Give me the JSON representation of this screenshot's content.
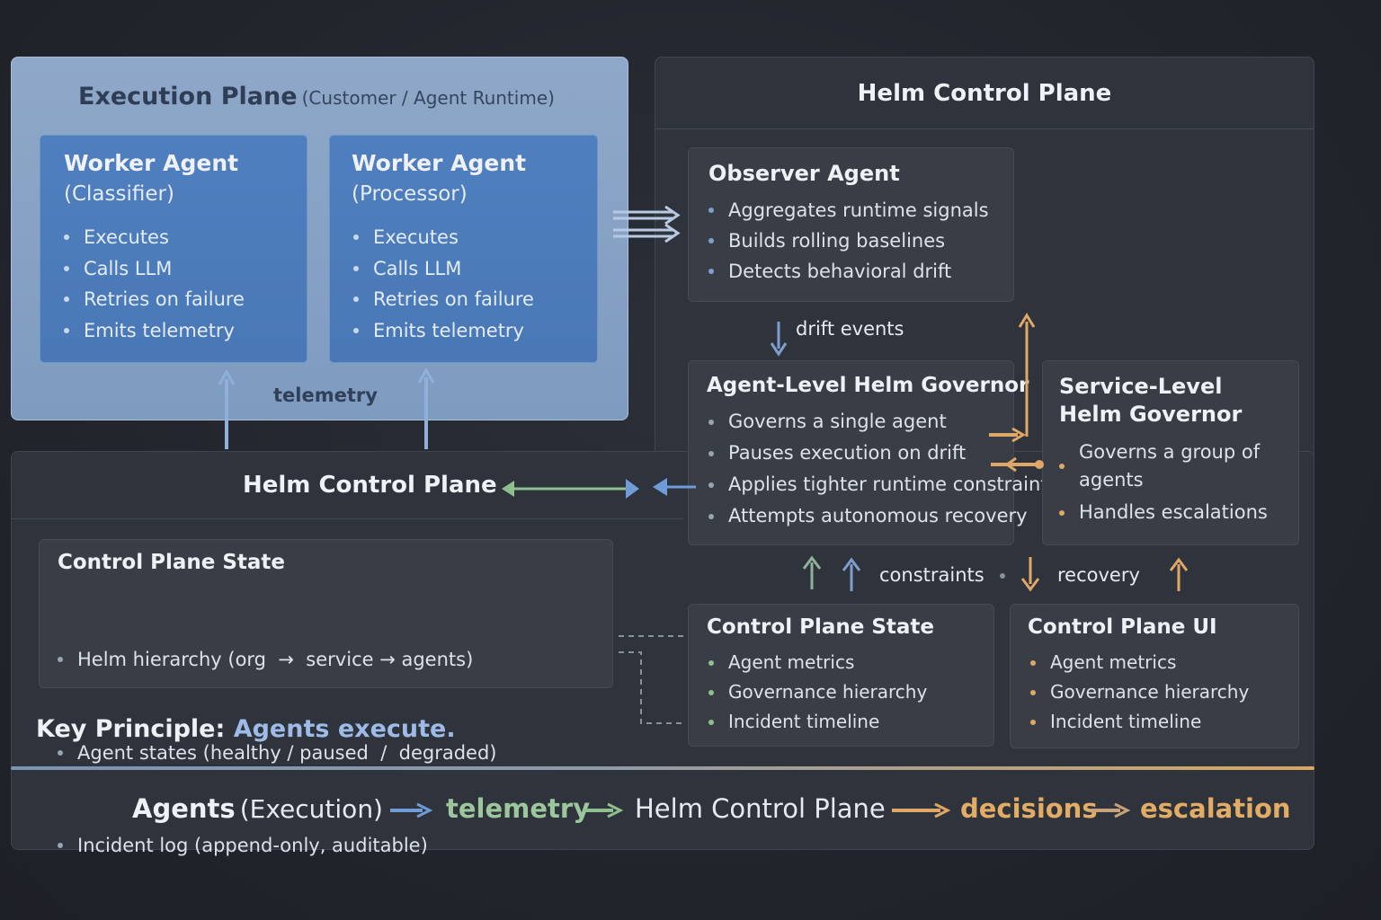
{
  "execution_plane": {
    "title": "Execution Plane",
    "subtitle": "(Customer / Agent Runtime)",
    "workers": [
      {
        "title": "Worker Agent",
        "role": "(Classifier)",
        "items": [
          "Executes",
          "Calls LLM",
          "Retries on failure",
          "Emits telemetry"
        ]
      },
      {
        "title": "Worker Agent",
        "role": "(Processor)",
        "items": [
          "Executes",
          "Calls LLM",
          "Retries on failure",
          "Emits telemetry"
        ]
      }
    ],
    "telemetry_label": "telemetry"
  },
  "helm_control_plane_right": {
    "title": "Helm Control Plane"
  },
  "observer_agent": {
    "title": "Observer Agent",
    "items": [
      "Aggregates runtime signals",
      "Builds rolling baselines",
      "Detects behavioral drift"
    ]
  },
  "drift_events_label": "drift events",
  "agent_governor": {
    "title": "Agent-Level Helm Governor",
    "items": [
      "Governs a single agent",
      "Pauses execution on drift",
      "Applies tighter runtime constraints",
      "Attempts autonomous recovery"
    ]
  },
  "service_governor": {
    "title_line1": "Service-Level",
    "title_line2": "Helm Governor",
    "items": [
      "Governs a group of agents",
      "Handles escalations"
    ]
  },
  "helm_control_plane_left": {
    "title": "Helm Control Plane"
  },
  "control_plane_state_left": {
    "title": "Control Plane State",
    "items": [
      "Helm hierarchy (org  →  service → agents)",
      "Agent states (healthy / paused  /  degraded)",
      "Incident log (append-only, auditable)"
    ]
  },
  "key_principle": {
    "label": "Key Principle:",
    "value": "Agents execute."
  },
  "constraints_label": "constraints",
  "recovery_label": "recovery",
  "control_plane_state_right": {
    "title": "Control Plane State",
    "items": [
      "Agent metrics",
      "Governance hierarchy",
      "Incident timeline"
    ]
  },
  "control_plane_ui": {
    "title": "Control Plane UI",
    "items": [
      "Agent metrics",
      "Governance hierarchy",
      "Incident timeline"
    ]
  },
  "flow": {
    "agents": "Agents",
    "agents_sub": "(Execution)",
    "telemetry": "telemetry",
    "helm": "Helm Control Plane",
    "decisions": "decisions",
    "escalation": "escalation"
  },
  "colors": {
    "blue": "#6f9bd6",
    "green": "#8fbf8f",
    "orange": "#e0a866",
    "accent_text": "#9dbbe6"
  }
}
